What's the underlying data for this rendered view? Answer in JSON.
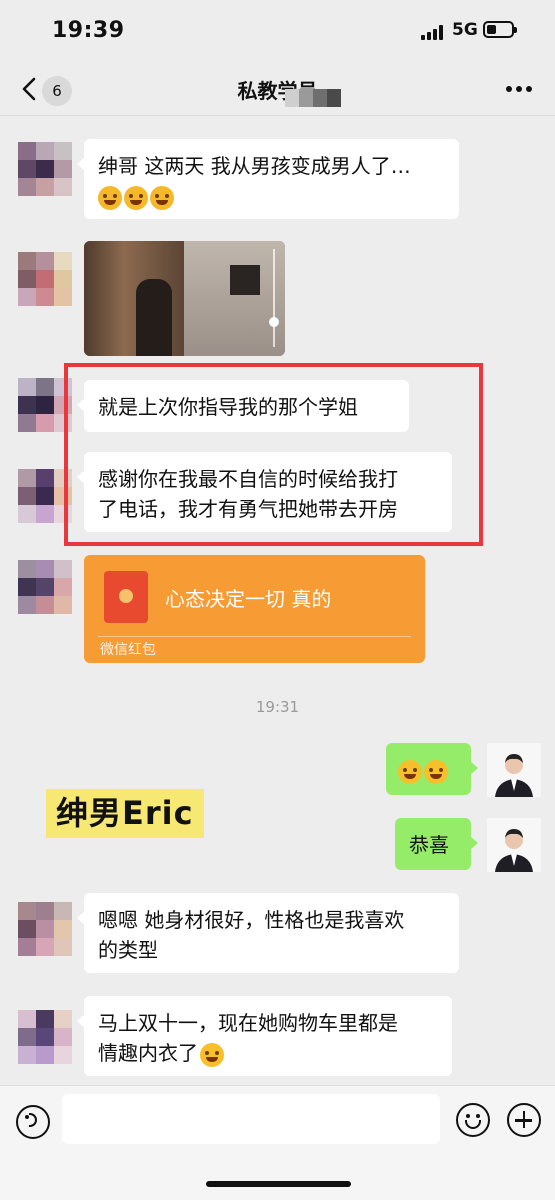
{
  "status_bar": {
    "time": "19:39",
    "network": "5G"
  },
  "nav": {
    "unread_badge": "6",
    "title": "私教学员"
  },
  "messages": [
    {
      "side": "left",
      "text": "绅哥 这两天 我从男孩变成男人了…",
      "emoji": [
        "face-tears-of-joy",
        "face-tears-of-joy",
        "face-tears-of-joy"
      ]
    },
    {
      "side": "left",
      "type": "image",
      "image_desc": "photo"
    },
    {
      "side": "left",
      "text": "就是上次你指导我的那个学姐"
    },
    {
      "side": "left",
      "text_line1": "感谢你在我最不自信的时候给我打",
      "text_line2": "了电话，我才有勇气把她带去开房"
    },
    {
      "side": "left",
      "type": "red-packet",
      "text": "心态决定一切 真的",
      "label": "微信红包"
    },
    {
      "timestamp": "19:31"
    },
    {
      "side": "right",
      "type": "emoji-only",
      "emoji": [
        "face-hand-over-mouth",
        "face-hand-over-mouth"
      ]
    },
    {
      "side": "right",
      "text": "恭喜"
    },
    {
      "side": "left",
      "text_line1": "嗯嗯 她身材很好，性格也是我喜欢",
      "text_line2": "的类型"
    },
    {
      "side": "left",
      "text_line1": "马上双十一，现在她购物车里都是",
      "text_line2": "情趣内衣了",
      "emoji": [
        "face-smirk"
      ]
    }
  ],
  "watermark": "绅男Eric",
  "input_bar": {
    "icons": [
      "voice-icon",
      "emoji-icon",
      "plus-icon"
    ]
  },
  "colors": {
    "bubble_self": "#95ec69",
    "bubble_other": "#ffffff",
    "red_packet": "#f79c35",
    "highlight_box": "#e8383d",
    "background": "#ededed"
  }
}
